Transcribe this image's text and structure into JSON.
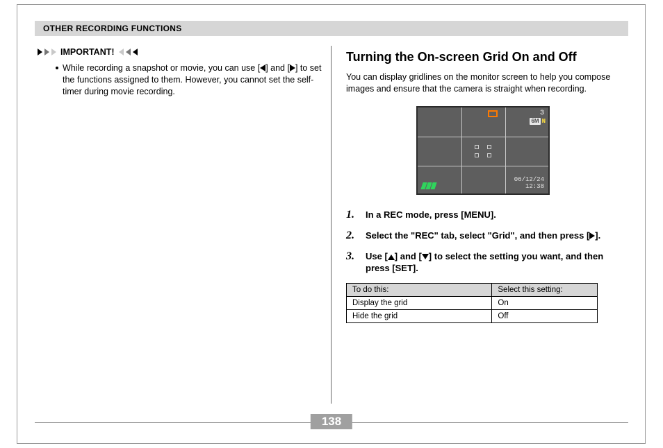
{
  "header": {
    "title": "OTHER RECORDING FUNCTIONS"
  },
  "left": {
    "important_label": "IMPORTANT!",
    "bullet_pre": "While recording a snapshot or movie, you can use [",
    "bullet_mid": "] and [",
    "bullet_post": "] to set the functions assigned to them. However, you cannot set the self-timer during movie recording."
  },
  "right": {
    "heading": "Turning the On-screen Grid On and Off",
    "intro": "You can display gridlines on the monitor screen to help you compose images and ensure that the camera is straight when recording.",
    "screen": {
      "shots": "3",
      "quality_box": "6M",
      "quality_suffix": "N",
      "date": "06/12/24",
      "time": "12:38"
    },
    "steps": [
      {
        "num": "1.",
        "text": "In a REC mode, press [MENU]."
      },
      {
        "num": "2.",
        "pre": "Select the \"REC\" tab, select \"Grid\", and then press [",
        "post": "]."
      },
      {
        "num": "3.",
        "pre": "Use [",
        "mid": "] and [",
        "post": "] to select the setting you want, and then press [SET]."
      }
    ],
    "table": {
      "h1": "To do this:",
      "h2": "Select this setting:",
      "rows": [
        {
          "a": "Display the grid",
          "b": "On"
        },
        {
          "a": "Hide the grid",
          "b": "Off"
        }
      ]
    }
  },
  "page_number": "138"
}
